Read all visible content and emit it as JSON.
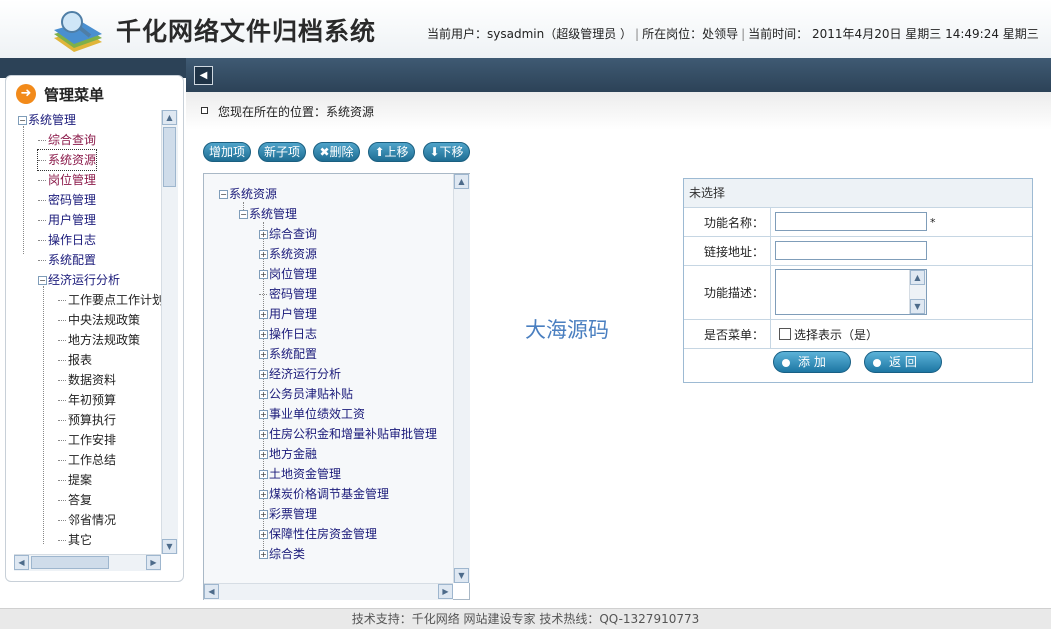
{
  "app": {
    "title": "千化网络文件归档系统"
  },
  "user_info": {
    "user_label": "当前用户：",
    "user_value": "sysadmin（超级管理员 ）",
    "post_label": "所在岗位：",
    "post_value": "处领导",
    "time_label": "当前时间：",
    "time_value": "2011年4月20日 星期三 14:49:24 星期三"
  },
  "sidebar": {
    "title": "管理菜单",
    "root": "系统管理",
    "items": [
      {
        "label": "综合查询"
      },
      {
        "label": "系统资源"
      },
      {
        "label": "岗位管理"
      },
      {
        "label": "密码管理"
      },
      {
        "label": "用户管理"
      },
      {
        "label": "操作日志"
      },
      {
        "label": "系统配置"
      },
      {
        "label": "经济运行分析"
      }
    ],
    "subitems": [
      {
        "label": "工作要点工作计划"
      },
      {
        "label": "中央法规政策"
      },
      {
        "label": "地方法规政策"
      },
      {
        "label": "报表"
      },
      {
        "label": "数据资料"
      },
      {
        "label": "年初预算"
      },
      {
        "label": "预算执行"
      },
      {
        "label": "工作安排"
      },
      {
        "label": "工作总结"
      },
      {
        "label": "提案"
      },
      {
        "label": "答复"
      },
      {
        "label": "邻省情况"
      },
      {
        "label": "其它"
      }
    ]
  },
  "breadcrumb": {
    "text": "您现在所在的位置：系统资源"
  },
  "toolbar": {
    "add": "增加项",
    "add_child": "新子项",
    "delete": "删除",
    "up": "上移",
    "down": "下移"
  },
  "tree": {
    "root": "系统资源",
    "child": "系统管理",
    "items": [
      {
        "label": "综合查询"
      },
      {
        "label": "系统资源"
      },
      {
        "label": "岗位管理"
      },
      {
        "label": "密码管理"
      },
      {
        "label": "用户管理"
      },
      {
        "label": "操作日志"
      },
      {
        "label": "系统配置"
      },
      {
        "label": "经济运行分析"
      },
      {
        "label": "公务员津贴补贴"
      },
      {
        "label": "事业单位绩效工资"
      },
      {
        "label": "住房公积金和增量补贴审批管理"
      },
      {
        "label": "地方金融"
      },
      {
        "label": "土地资金管理"
      },
      {
        "label": "煤炭价格调节基金管理"
      },
      {
        "label": "彩票管理"
      },
      {
        "label": "保障性住房资金管理"
      },
      {
        "label": "综合类"
      }
    ]
  },
  "watermark": "大海源码",
  "form": {
    "header": "未选择",
    "name_label": "功能名称：",
    "name_value": "",
    "required_mark": "*",
    "link_label": "链接地址：",
    "link_value": "",
    "desc_label": "功能描述：",
    "menu_label": "是否菜单：",
    "checkbox_label": "选择表示（是）",
    "add_button": "添 加",
    "back_button": "返 回"
  },
  "footer": {
    "text": "技术支持：千化网络  网站建设专家   技术热线：QQ-1327910773"
  }
}
